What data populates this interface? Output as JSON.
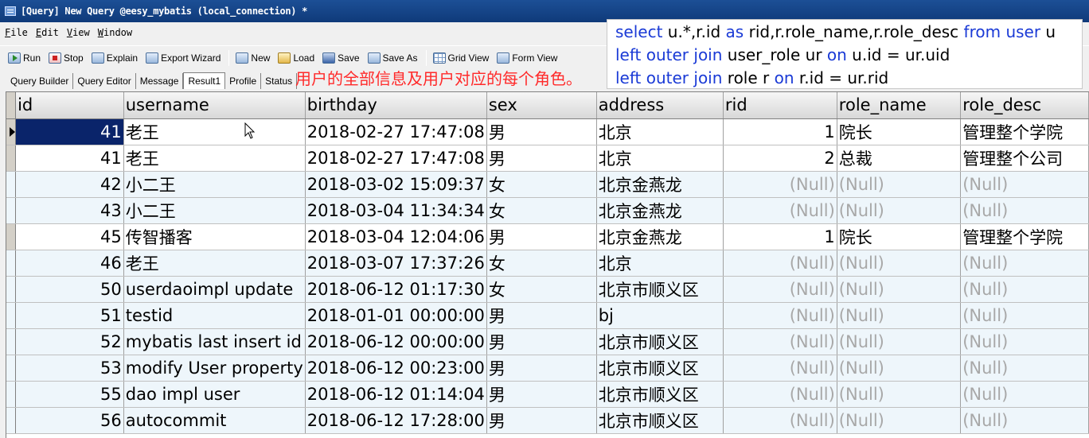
{
  "window": {
    "title": "[Query] New Query @eesy_mybatis (local_connection) *"
  },
  "menu": [
    "File",
    "Edit",
    "View",
    "Window"
  ],
  "toolbar": {
    "run": "Run",
    "stop": "Stop",
    "explain": "Explain",
    "export": "Export Wizard",
    "new": "New",
    "load": "Load",
    "save": "Save",
    "save_as": "Save As",
    "grid_view": "Grid View",
    "form_view": "Form View"
  },
  "tabs": [
    "Query Builder",
    "Query Editor",
    "Message",
    "Result1",
    "Profile",
    "Status"
  ],
  "active_tab": "Result1",
  "annotation": "用户的全部信息及用户对应的每个角色。",
  "sql": {
    "line1": {
      "k1": "select",
      "t1": " u.*,r.id ",
      "k2": "as",
      "t2": " rid,r.role_name,r.role_desc ",
      "k3": "from",
      "t3": " ",
      "k4": "user",
      "t4": " u"
    },
    "line2": {
      "k1": "left outer join",
      "t1": " user_role ur  ",
      "k2": "on",
      "t2": " u.id = ur.uid"
    },
    "line3": {
      "k1": "left outer join",
      "t1": " role r ",
      "k2": "on",
      "t2": " r.id = ur.rid"
    }
  },
  "grid": {
    "columns": [
      "id",
      "username",
      "birthday",
      "sex",
      "address",
      "rid",
      "role_name",
      "role_desc"
    ],
    "null_text": "(Null)",
    "rows": [
      {
        "id": "41",
        "username": "老王",
        "birthday": "2018-02-27 17:47:08",
        "sex": "男",
        "address": "北京",
        "rid": "1",
        "role_name": "院长",
        "role_desc": "管理整个学院"
      },
      {
        "id": "41",
        "username": "老王",
        "birthday": "2018-02-27 17:47:08",
        "sex": "男",
        "address": "北京",
        "rid": "2",
        "role_name": "总裁",
        "role_desc": "管理整个公司"
      },
      {
        "id": "42",
        "username": "小二王",
        "birthday": "2018-03-02 15:09:37",
        "sex": "女",
        "address": "北京金燕龙",
        "rid": null,
        "role_name": null,
        "role_desc": null
      },
      {
        "id": "43",
        "username": "小二王",
        "birthday": "2018-03-04 11:34:34",
        "sex": "女",
        "address": "北京金燕龙",
        "rid": null,
        "role_name": null,
        "role_desc": null
      },
      {
        "id": "45",
        "username": "传智播客",
        "birthday": "2018-03-04 12:04:06",
        "sex": "男",
        "address": "北京金燕龙",
        "rid": "1",
        "role_name": "院长",
        "role_desc": "管理整个学院"
      },
      {
        "id": "46",
        "username": "老王",
        "birthday": "2018-03-07 17:37:26",
        "sex": "女",
        "address": "北京",
        "rid": null,
        "role_name": null,
        "role_desc": null
      },
      {
        "id": "50",
        "username": "userdaoimpl update",
        "birthday": "2018-06-12 01:17:30",
        "sex": "女",
        "address": "北京市顺义区",
        "rid": null,
        "role_name": null,
        "role_desc": null
      },
      {
        "id": "51",
        "username": "testid",
        "birthday": "2018-01-01 00:00:00",
        "sex": "男",
        "address": "bj",
        "rid": null,
        "role_name": null,
        "role_desc": null
      },
      {
        "id": "52",
        "username": "mybatis last insert id",
        "birthday": "2018-06-12 00:00:00",
        "sex": "男",
        "address": "北京市顺义区",
        "rid": null,
        "role_name": null,
        "role_desc": null
      },
      {
        "id": "53",
        "username": "modify User property",
        "birthday": "2018-06-12 00:23:00",
        "sex": "男",
        "address": "北京市顺义区",
        "rid": null,
        "role_name": null,
        "role_desc": null
      },
      {
        "id": "55",
        "username": "dao impl user",
        "birthday": "2018-06-12 01:14:04",
        "sex": "男",
        "address": "北京市顺义区",
        "rid": null,
        "role_name": null,
        "role_desc": null
      },
      {
        "id": "56",
        "username": "autocommit",
        "birthday": "2018-06-12 17:28:00",
        "sex": "男",
        "address": "北京市顺义区",
        "rid": null,
        "role_name": null,
        "role_desc": null
      }
    ]
  }
}
